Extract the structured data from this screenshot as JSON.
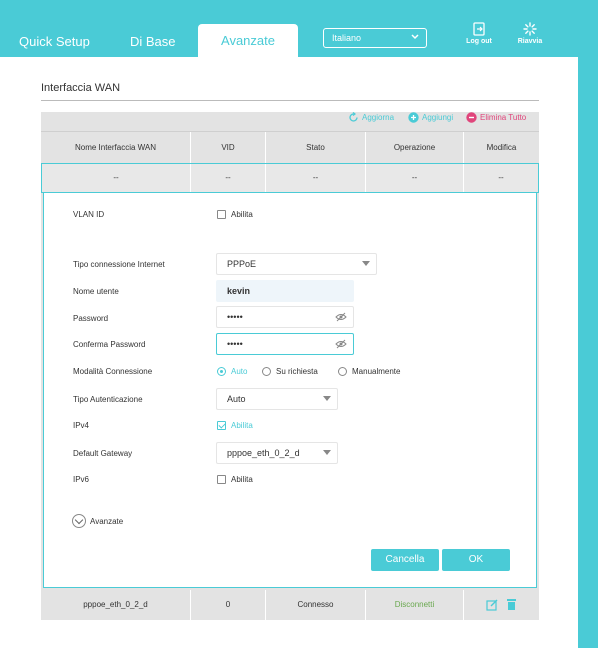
{
  "nav": {
    "tabs": [
      {
        "label": "Quick Setup"
      },
      {
        "label": "Di Base"
      },
      {
        "label": "Avanzate",
        "active": true
      }
    ],
    "language": "Italiano",
    "logout_label": "Log out",
    "reboot_label": "Riavvia"
  },
  "section": {
    "title": "Interfaccia WAN"
  },
  "toolbar": {
    "refresh": "Aggiorna",
    "add": "Aggiungi",
    "delete_all": "Elimina Tutto"
  },
  "table": {
    "headers": [
      "Nome Interfaccia WAN",
      "VID",
      "Stato",
      "Operazione",
      "Modifica"
    ],
    "new_row": [
      "--",
      "--",
      "--",
      "--",
      "--"
    ],
    "rows": [
      {
        "name": "pppoe_eth_0_2_d",
        "vid": "0",
        "status": "Connesso",
        "operation": "Disconnetti"
      }
    ]
  },
  "form": {
    "vlan_id_label": "VLAN ID",
    "vlan_enable_label": "Abilita",
    "vlan_enabled": false,
    "conn_type_label": "Tipo connessione Internet",
    "conn_type_value": "PPPoE",
    "username_label": "Nome utente",
    "username_value": "kevin",
    "password_label": "Password",
    "password_value": "•••••",
    "confirm_label": "Conferma Password",
    "confirm_value": "•••••",
    "mode_label": "Modalità Connessione",
    "mode_options": [
      "Auto",
      "Su richiesta",
      "Manualmente"
    ],
    "mode_selected": "Auto",
    "auth_label": "Tipo Autenticazione",
    "auth_value": "Auto",
    "ipv4_label": "IPv4",
    "ipv4_enable_label": "Abilita",
    "ipv4_enabled": true,
    "gateway_label": "Default Gateway",
    "gateway_value": "pppoe_eth_0_2_d",
    "ipv6_label": "IPv6",
    "ipv6_enable_label": "Abilita",
    "ipv6_enabled": false,
    "advanced_label": "Avanzate",
    "cancel_label": "Cancella",
    "ok_label": "OK"
  },
  "colors": {
    "accent": "#4acbd6",
    "delete": "#e0457b",
    "disconnect": "#6aa84f"
  }
}
